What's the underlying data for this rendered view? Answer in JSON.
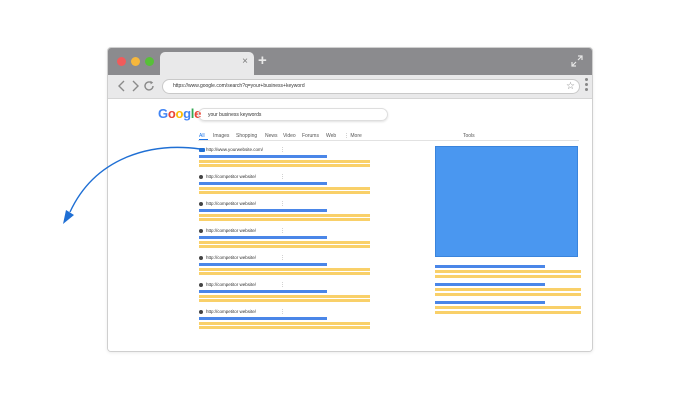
{
  "browser": {
    "tab_close": "×",
    "new_tab": "+",
    "url": "https://www.google.com/search?q=your+business+keyword"
  },
  "search": {
    "logo": [
      "G",
      "o",
      "o",
      "g",
      "l",
      "e"
    ],
    "logo_colors": [
      "#4285f4",
      "#ea4335",
      "#fbbc05",
      "#4285f4",
      "#34a853",
      "#ea4335"
    ],
    "query": "your business keywords",
    "tabs": [
      "All",
      "Images",
      "Shopping",
      "News",
      "Video",
      "Forums",
      "Web",
      "⋮ More"
    ],
    "tools": "Tools"
  },
  "results": [
    {
      "url": "http://www.yourwebsite.com/",
      "type": "ad"
    },
    {
      "url": "http://competitor website/",
      "type": "organic"
    },
    {
      "url": "http://competitor website/",
      "type": "organic"
    },
    {
      "url": "http://competitor website/",
      "type": "organic"
    },
    {
      "url": "http://competitor website/",
      "type": "organic"
    },
    {
      "url": "http://competitor website/",
      "type": "organic"
    },
    {
      "url": "http://competitor website/",
      "type": "organic"
    }
  ],
  "icons": {
    "back": "chevron-left-icon",
    "forward": "chevron-right-icon",
    "reload": "reload-icon",
    "star": "star-icon",
    "expand": "expand-icon",
    "ad": "ad-badge-icon"
  },
  "colors": {
    "accent_blue": "#4a86e8",
    "highlight_yellow": "#f9d069",
    "panel_blue": "#4a97f0",
    "arrow_blue": "#1f6fd4"
  }
}
